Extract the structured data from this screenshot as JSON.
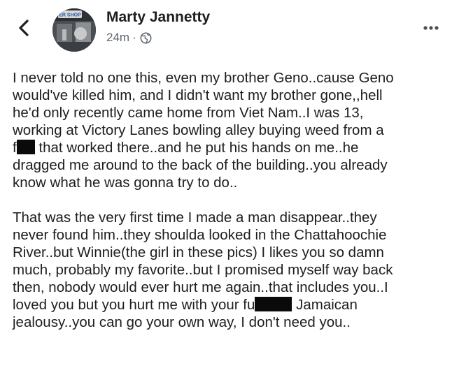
{
  "header": {
    "author_name": "Marty Jannetty",
    "timestamp": "24m",
    "separator": "·",
    "back_icon": "chevron-left-icon",
    "audience_icon": "globe-icon",
    "more_icon": "more-horizontal-icon",
    "avatar_sign_text": "ER SHOP"
  },
  "post": {
    "paragraph1": [
      "I never told no one this, even my brother Geno..cause Geno",
      "would've killed him, and I didn't want my brother gone,,hell",
      "he'd only recently came home from Viet Nam..I was 13,",
      "working at Victory Lanes bowling alley buying weed from a",
      {
        "before": "f",
        "after": " that worked there..and he put his hands on me..he"
      },
      "dragged me around to the back of the building..you already",
      "know what he was gonna try to do.."
    ],
    "paragraph2": [
      "That was the very first time I made a man disappear..they",
      "never found him..they shoulda looked in the Chattahoochie",
      "River..but Winnie(the girl in these pics) I likes you so damn",
      "much, probably my favorite..but I promised myself way back",
      "then, nobody would ever hurt me again..that includes you..I",
      {
        "before": "loved you but you hurt me with your fu",
        "after": " Jamaican"
      },
      "jealousy..you can go your own way, I don't need you.."
    ]
  },
  "colors": {
    "text": "#1c1e21",
    "meta_text": "#606770",
    "icon": "#4b4f56",
    "redaction": "#0a0a0a",
    "background": "#ffffff"
  }
}
